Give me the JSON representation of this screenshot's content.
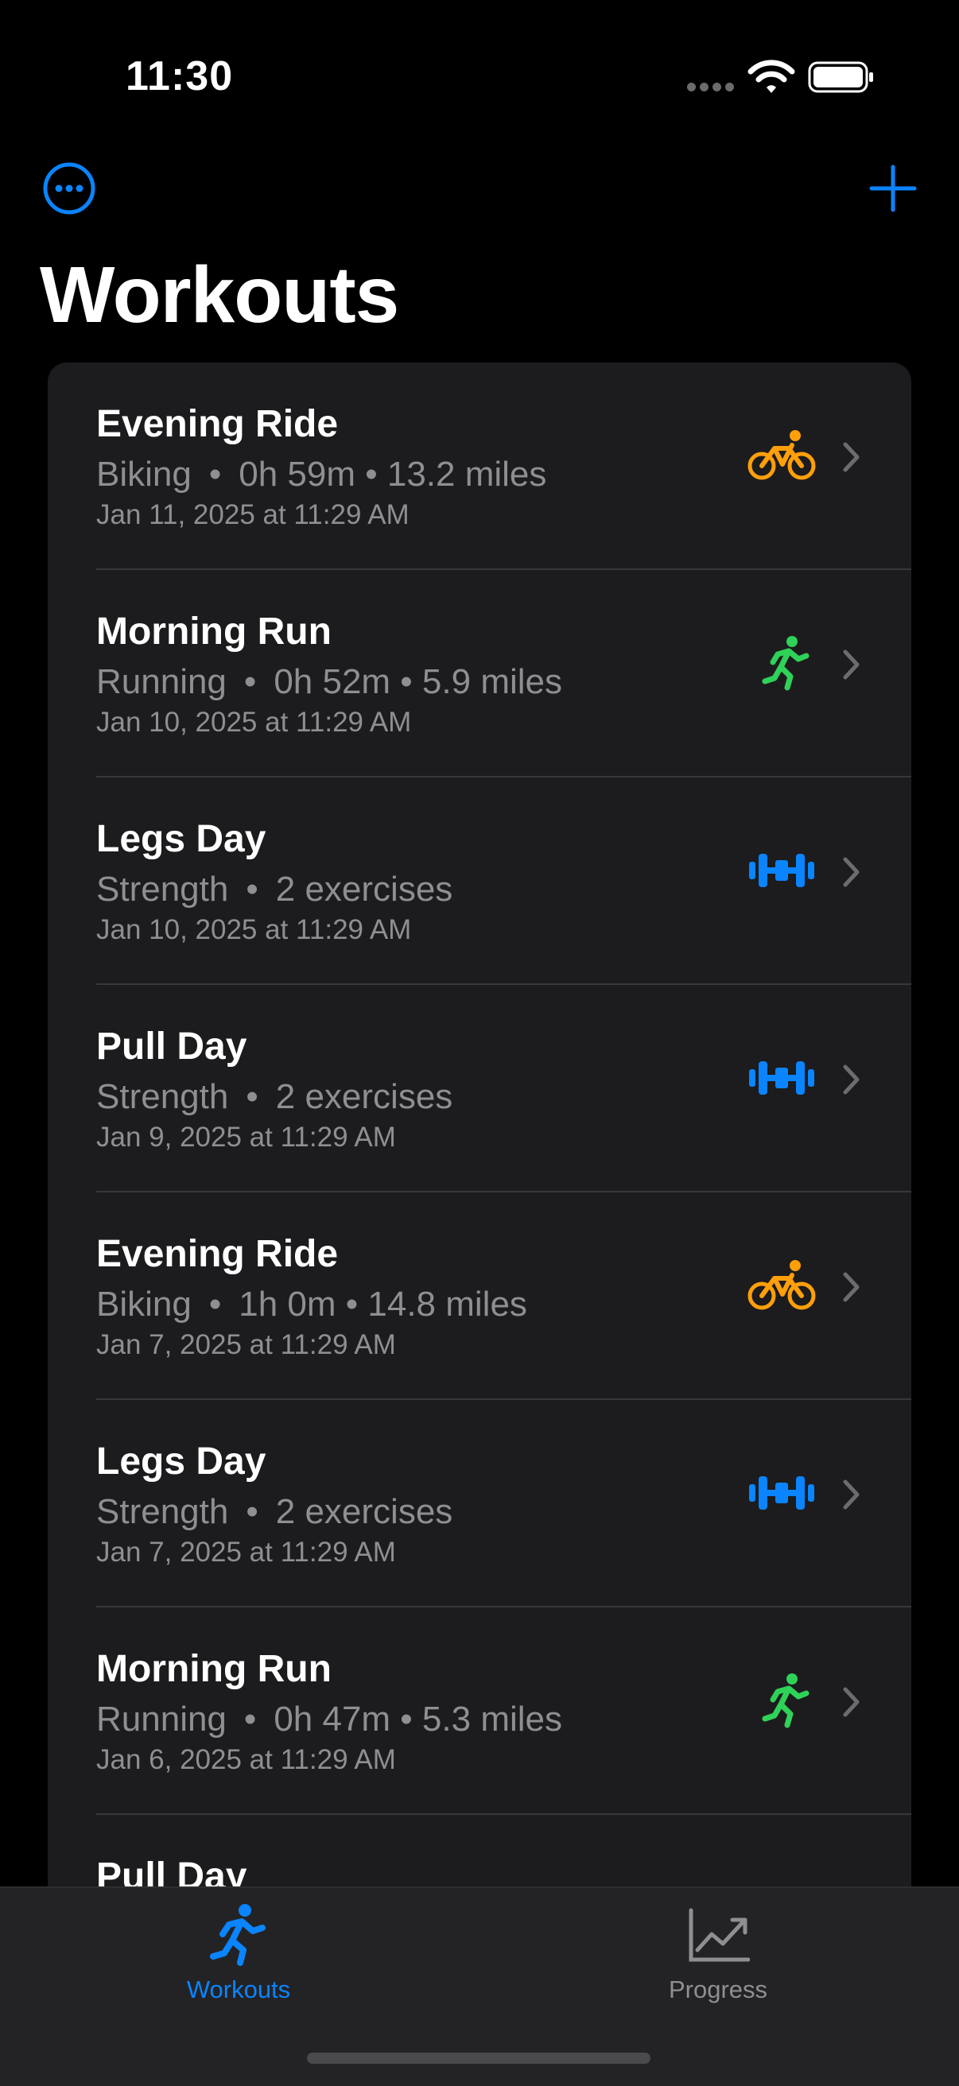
{
  "status_bar": {
    "time": "11:30"
  },
  "nav": {
    "title": "Workouts",
    "more_icon": "ellipsis-circle-icon",
    "add_icon": "plus-icon",
    "accent_color": "#0a84ff"
  },
  "workouts": [
    {
      "name": "Evening Ride",
      "type": "Biking",
      "stats": "0h 59m • 13.2 miles",
      "date": "Jan 11, 2025 at 11:29 AM",
      "icon": "bicycle-icon",
      "icon_color": "#ff9f0a"
    },
    {
      "name": "Morning Run",
      "type": "Running",
      "stats": "0h 52m • 5.9 miles",
      "date": "Jan 10, 2025 at 11:29 AM",
      "icon": "running-icon",
      "icon_color": "#30d158"
    },
    {
      "name": "Legs Day",
      "type": "Strength",
      "stats": "2 exercises",
      "date": "Jan 10, 2025 at 11:29 AM",
      "icon": "dumbbell-icon",
      "icon_color": "#0a84ff"
    },
    {
      "name": "Pull Day",
      "type": "Strength",
      "stats": "2 exercises",
      "date": "Jan 9, 2025 at 11:29 AM",
      "icon": "dumbbell-icon",
      "icon_color": "#0a84ff"
    },
    {
      "name": "Evening Ride",
      "type": "Biking",
      "stats": "1h 0m • 14.8 miles",
      "date": "Jan 7, 2025 at 11:29 AM",
      "icon": "bicycle-icon",
      "icon_color": "#ff9f0a"
    },
    {
      "name": "Legs Day",
      "type": "Strength",
      "stats": "2 exercises",
      "date": "Jan 7, 2025 at 11:29 AM",
      "icon": "dumbbell-icon",
      "icon_color": "#0a84ff"
    },
    {
      "name": "Morning Run",
      "type": "Running",
      "stats": "0h 47m • 5.3 miles",
      "date": "Jan 6, 2025 at 11:29 AM",
      "icon": "running-icon",
      "icon_color": "#30d158"
    },
    {
      "name": "Pull Day"
    }
  ],
  "tabs": [
    {
      "label": "Workouts",
      "icon": "running-figure-icon",
      "selected": true,
      "color": "#0a84ff"
    },
    {
      "label": "Progress",
      "icon": "chart-line-uptrend-icon",
      "selected": false,
      "color": "#8e8e93"
    }
  ]
}
